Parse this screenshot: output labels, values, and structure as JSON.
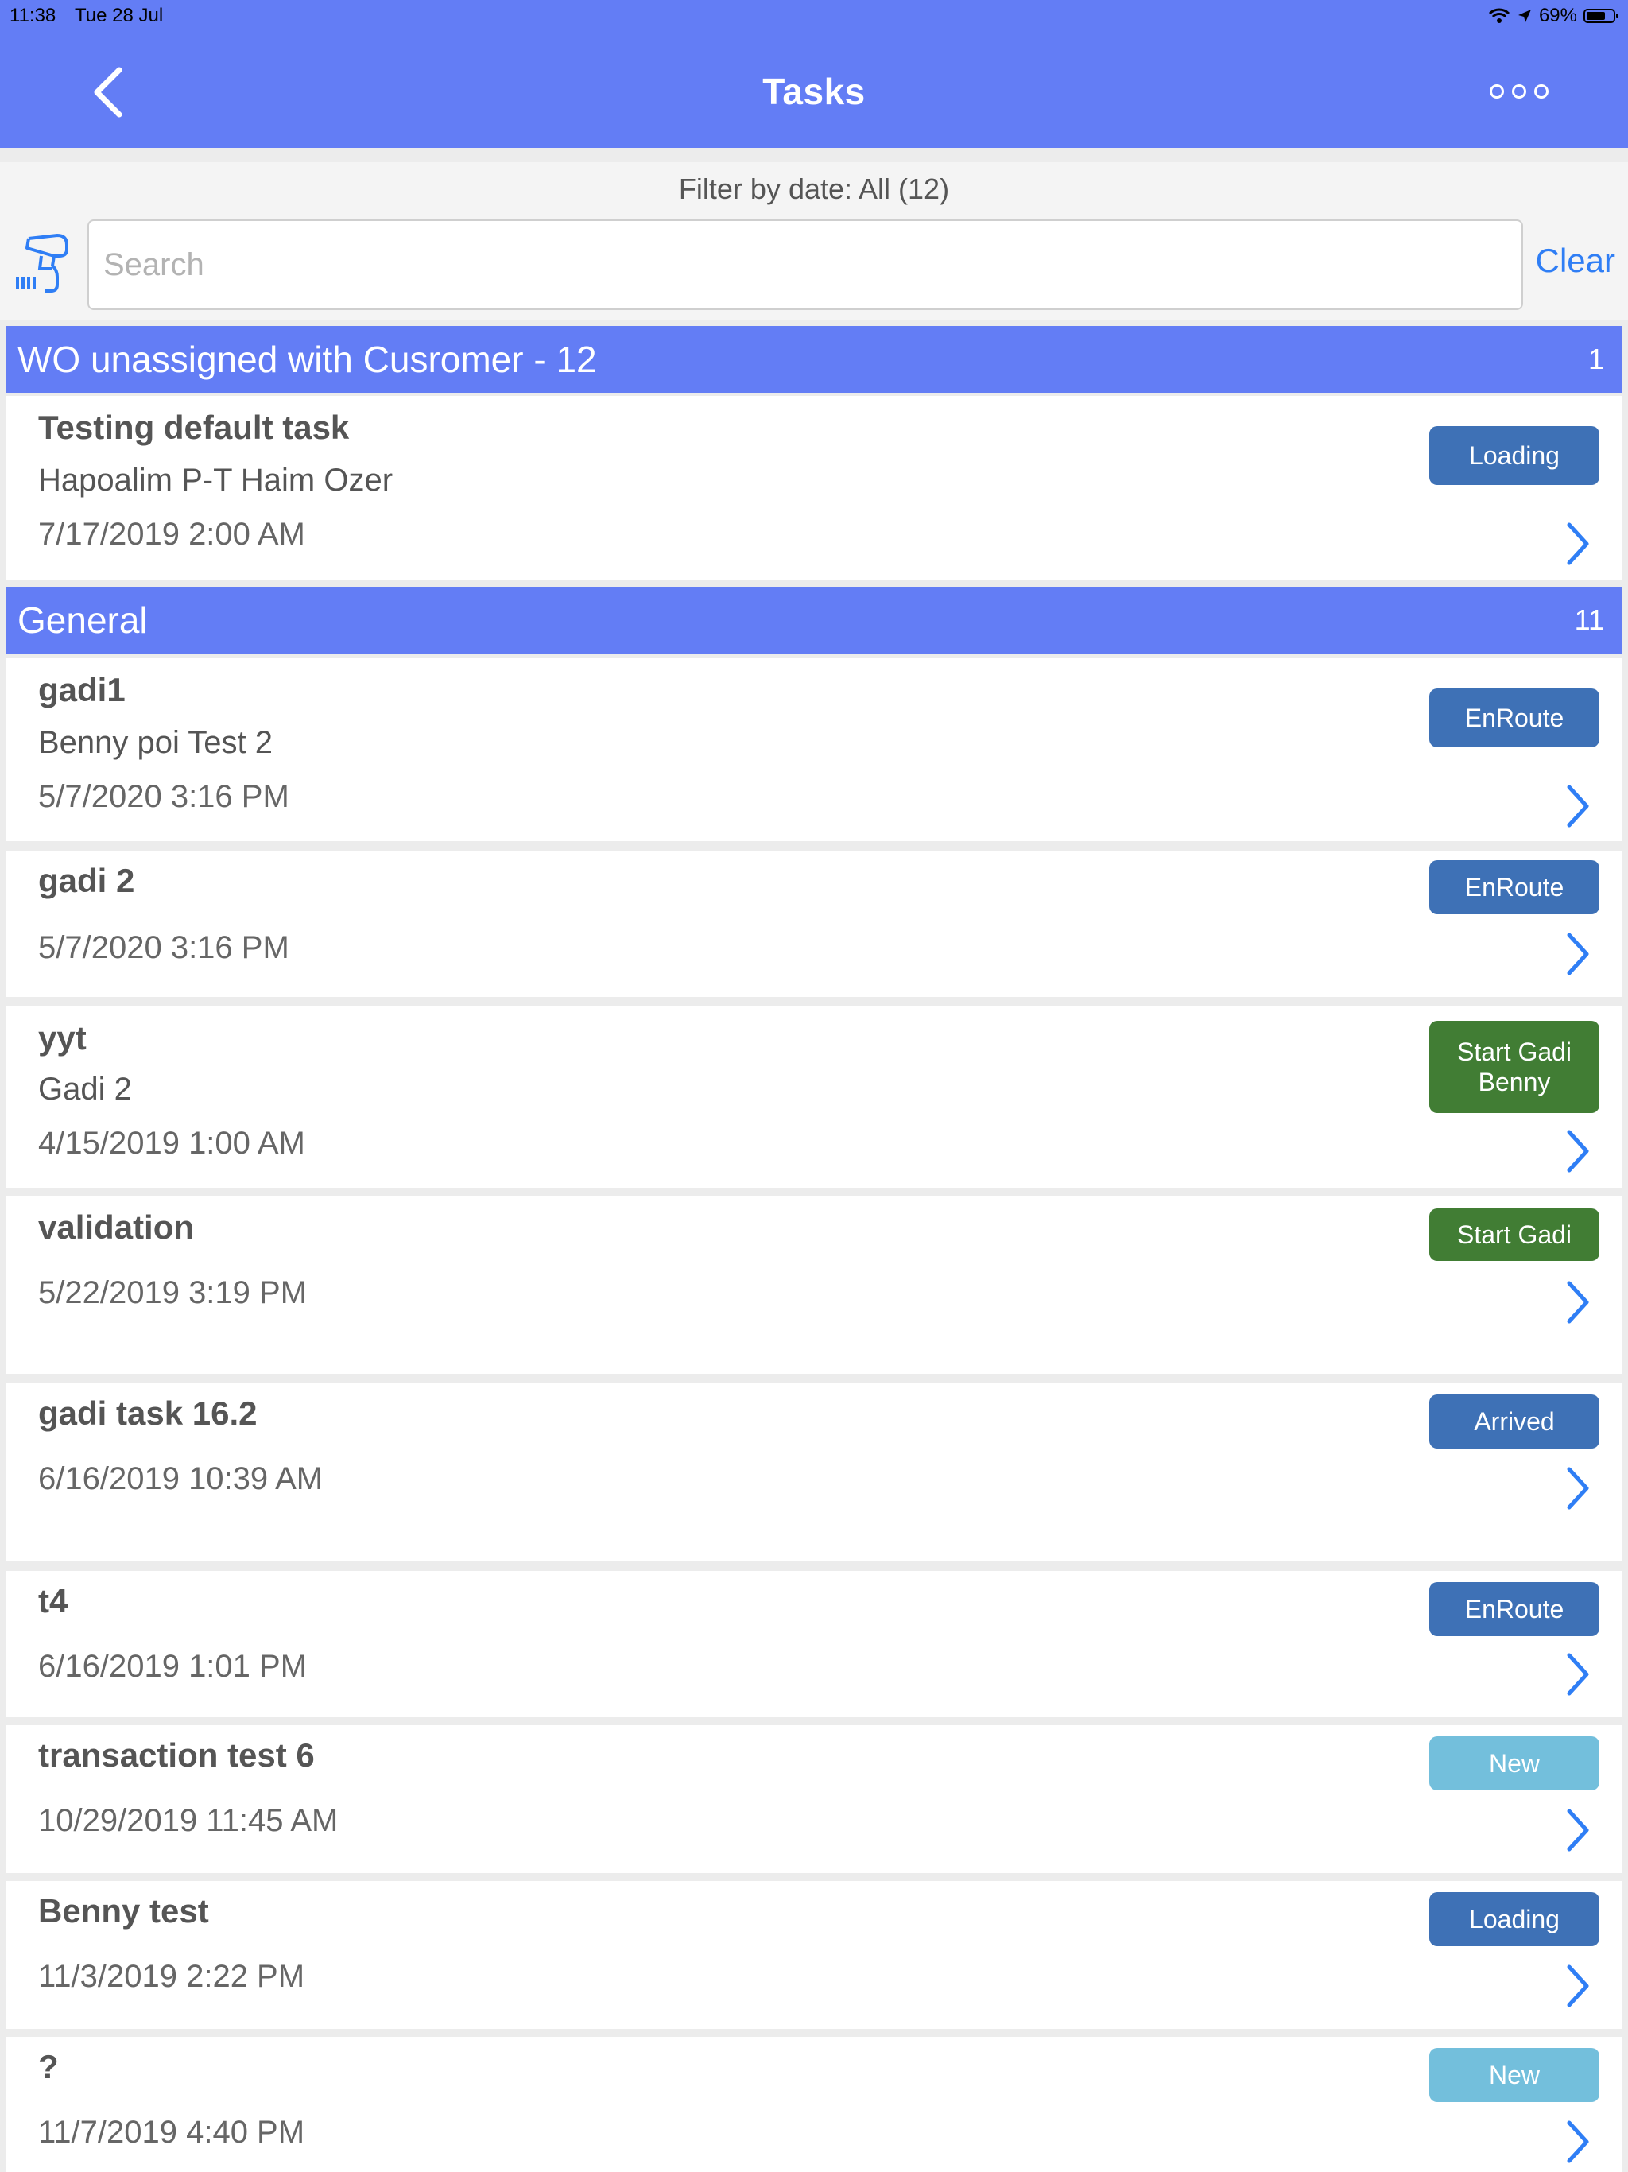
{
  "status_bar": {
    "time": "11:38",
    "date": "Tue 28 Jul",
    "battery": "69%",
    "battery_level": 0.69
  },
  "header": {
    "title": "Tasks",
    "back_icon": "chevron-left-icon",
    "more_icon": "more-dots-icon"
  },
  "filter": {
    "label": "Filter by date: All (12)"
  },
  "search": {
    "placeholder": "Search",
    "value": "",
    "clear_label": "Clear",
    "scanner_icon": "barcode-scanner-icon"
  },
  "colors": {
    "header": "#637df5",
    "badge_dark": "#3e71b6",
    "badge_green": "#417d34",
    "badge_light": "#73bfdc",
    "link": "#2f7ef5"
  },
  "sections": [
    {
      "title": "WO unassigned with Cusromer - 12",
      "count": "1",
      "tasks": [
        {
          "name": "Testing default task",
          "subtitle": "Hapoalim P-T Haim Ozer",
          "date": "7/17/2019 2:00 AM",
          "status": "Loading"
        }
      ]
    },
    {
      "title": "General",
      "count": "11",
      "tasks": [
        {
          "name": "gadi1",
          "subtitle": "Benny poi Test 2",
          "date": "5/7/2020 3:16 PM",
          "status": "EnRoute"
        },
        {
          "name": "gadi 2",
          "subtitle": "",
          "date": "5/7/2020 3:16 PM",
          "status": "EnRoute"
        },
        {
          "name": "yyt",
          "subtitle": "Gadi 2",
          "date": "4/15/2019 1:00 AM",
          "status": "Start Gadi Benny"
        },
        {
          "name": "validation",
          "subtitle": "",
          "date": "5/22/2019 3:19 PM",
          "status": "Start Gadi"
        },
        {
          "name": "gadi task 16.2",
          "subtitle": "",
          "date": "6/16/2019 10:39 AM",
          "status": "Arrived"
        },
        {
          "name": "t4",
          "subtitle": "",
          "date": "6/16/2019 1:01 PM",
          "status": "EnRoute"
        },
        {
          "name": "transaction test 6",
          "subtitle": "",
          "date": "10/29/2019 11:45 AM",
          "status": "New"
        },
        {
          "name": "Benny test",
          "subtitle": "",
          "date": "11/3/2019 2:22 PM",
          "status": "Loading"
        },
        {
          "name": "?",
          "subtitle": "",
          "date": "11/7/2019 4:40 PM",
          "status": "New"
        }
      ]
    }
  ]
}
